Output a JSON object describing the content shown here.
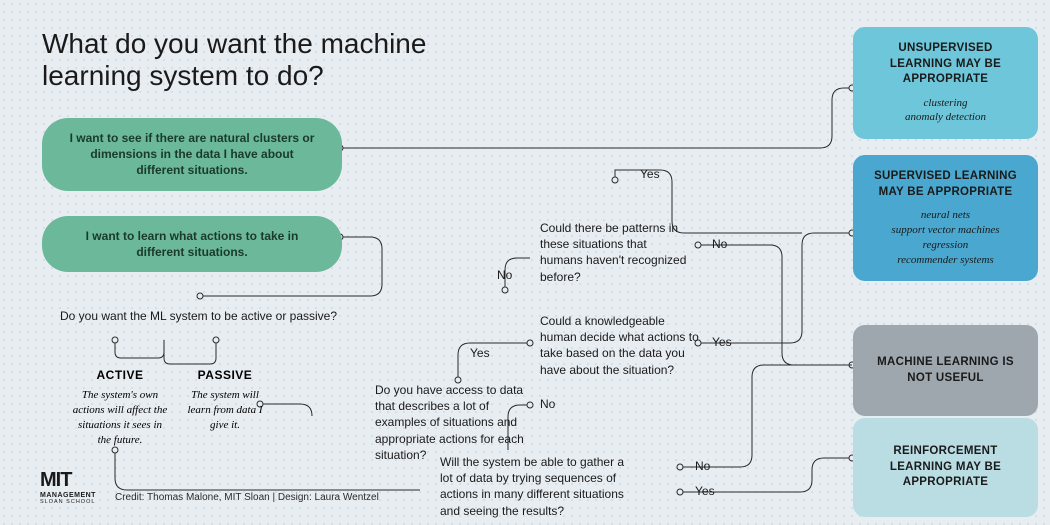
{
  "title": "What do you want the machine learning system to do?",
  "pills": {
    "clusters": "I want to see if there are natural clusters or dimensions in the data I have about different situations.",
    "actions": "I want to learn what actions to take in different situations."
  },
  "questions": {
    "active_passive": "Do you want the ML system to be active or passive?",
    "have_data": "Do you have access to data that describes a lot of examples of situations and appropriate actions for each situation?",
    "human_decide": "Could a knowledgeable human decide what actions to take based on the data you have about the situation?",
    "patterns": "Could there be patterns in these situations that humans haven't recognized before?",
    "gather": "Will the system be able to gather a lot of data by trying sequences of actions in many different situations and seeing the results?"
  },
  "choices": {
    "active": {
      "head": "ACTIVE",
      "sub": "The system's own actions will affect the situations it sees in the future."
    },
    "passive": {
      "head": "PASSIVE",
      "sub": "The system will learn from data I give it."
    }
  },
  "answers": {
    "yes": "Yes",
    "no": "No"
  },
  "results": {
    "unsupervised": {
      "title": "UNSUPERVISED LEARNING MAY BE APPROPRIATE",
      "sub": "clustering\nanomaly detection",
      "color": "#6dc6d9"
    },
    "supervised": {
      "title": "SUPERVISED LEARNING MAY BE APPROPRIATE",
      "sub": "neural nets\nsupport vector machines\nregression\nrecommender systems",
      "color": "#4aa7cf"
    },
    "not_useful": {
      "title": "MACHINE LEARNING IS NOT USEFUL",
      "sub": "",
      "color": "#9ea6ae"
    },
    "reinforcement": {
      "title": "REINFORCEMENT LEARNING MAY BE APPROPRIATE",
      "sub": "",
      "color": "#b9dde3"
    }
  },
  "credit": "Credit: Thomas Malone, MIT Sloan | Design: Laura Wentzel",
  "logo": {
    "line1": "MIT",
    "line2": "MANAGEMENT",
    "line3": "SLOAN SCHOOL"
  }
}
